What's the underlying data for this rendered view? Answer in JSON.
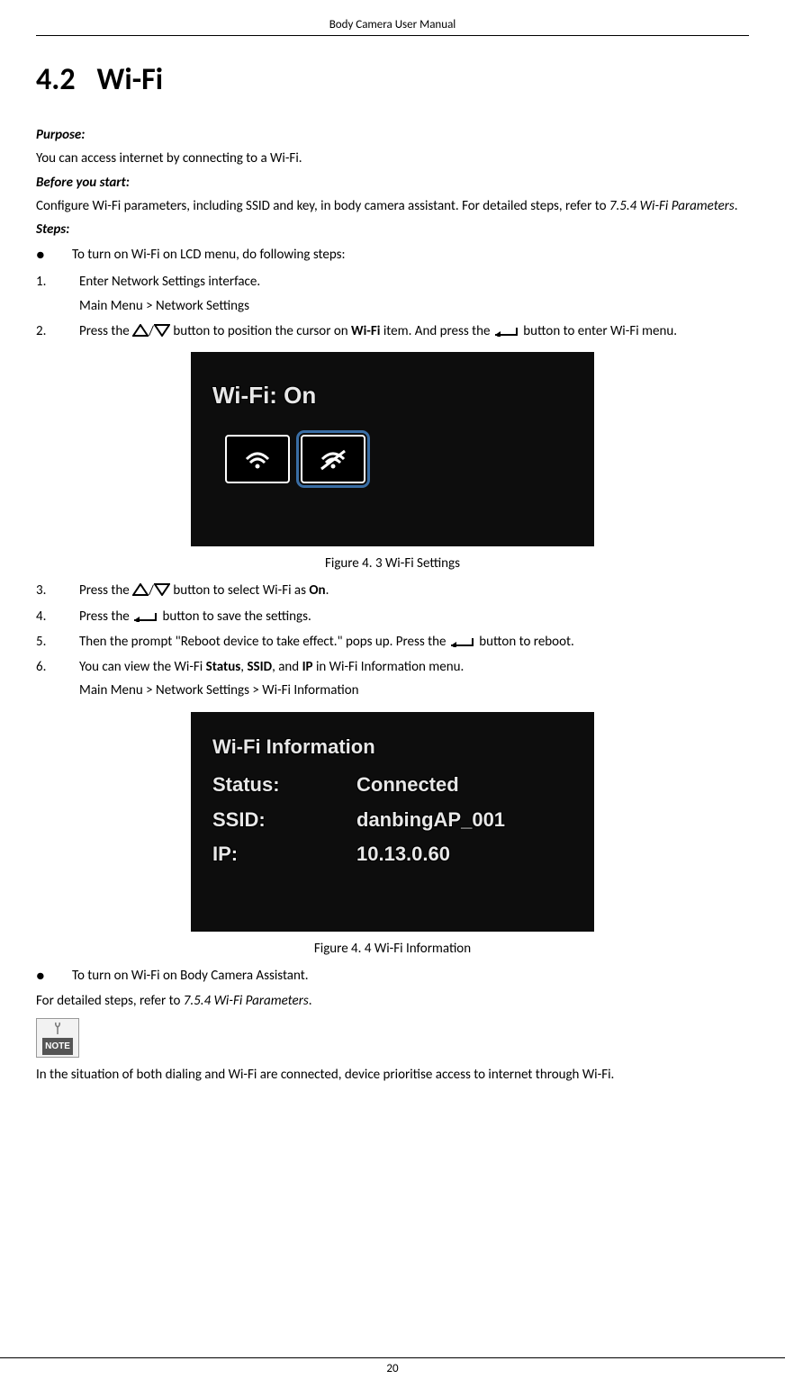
{
  "header": "Body Camera User Manual",
  "section": {
    "num": "4.2",
    "title": "Wi-Fi"
  },
  "purpose": {
    "label": "Purpose:",
    "text": "You can access internet by connecting to a Wi-Fi."
  },
  "before": {
    "label": "Before you start:",
    "text_pre": "Configure Wi-Fi parameters, including SSID and key, in body camera assistant. For detailed steps, refer to ",
    "ref": "7.5.4 Wi-Fi Parameters",
    "text_post": "."
  },
  "steps_label": "Steps:",
  "bullet1": "To turn on Wi-Fi on LCD menu, do following steps:",
  "steps": {
    "s1": {
      "num": "1.",
      "text": "Enter Network Settings interface.",
      "path": "Main Menu > Network Settings"
    },
    "s2": {
      "num": "2.",
      "t1": "Press the ",
      "t2": " button to position the cursor on ",
      "b1": "Wi-Fi",
      "t3": " item. And press the ",
      "t4": " button to enter Wi-Fi menu."
    },
    "s3": {
      "num": "3.",
      "t1": "Press the ",
      "t2": " button to select Wi-Fi as ",
      "b1": "On",
      "t3": "."
    },
    "s4": {
      "num": "4.",
      "t1": "Press the ",
      "t2": " button to save the settings."
    },
    "s5": {
      "num": "5.",
      "t1": "Then the prompt \"Reboot device to take effect.\" pops up. Press the ",
      "t2": " button to reboot."
    },
    "s6": {
      "num": "6.",
      "t1": "You can view the Wi-Fi ",
      "b1": "Status",
      "c1": ", ",
      "b2": "SSID",
      "c2": ", and ",
      "b3": "IP",
      "t2": " in Wi-Fi Information menu.",
      "path": "Main Menu > Network Settings > Wi-Fi Information"
    }
  },
  "fig1": {
    "title": "Wi-Fi: On",
    "caption_pre": "Figure 4. 3",
    "caption": "Wi-Fi Settings"
  },
  "fig2": {
    "title": "Wi-Fi Information",
    "rows": {
      "r1": {
        "k": "Status:",
        "v": "Connected"
      },
      "r2": {
        "k": "SSID:",
        "v": "danbingAP_001"
      },
      "r3": {
        "k": "IP:",
        "v": "10.13.0.60"
      }
    },
    "caption_pre": "Figure 4. 4",
    "caption": "Wi-Fi Information"
  },
  "bullet2": "To turn on Wi-Fi on Body Camera Assistant.",
  "ref_line": {
    "t1": "For detailed steps, refer to ",
    "ref": "7.5.4 Wi-Fi Parameters",
    "t2": "."
  },
  "note_label": "NOTE",
  "note_text": "In the situation of both dialing and Wi-Fi are connected, device prioritise access to internet through Wi-Fi.",
  "page_num": "20"
}
